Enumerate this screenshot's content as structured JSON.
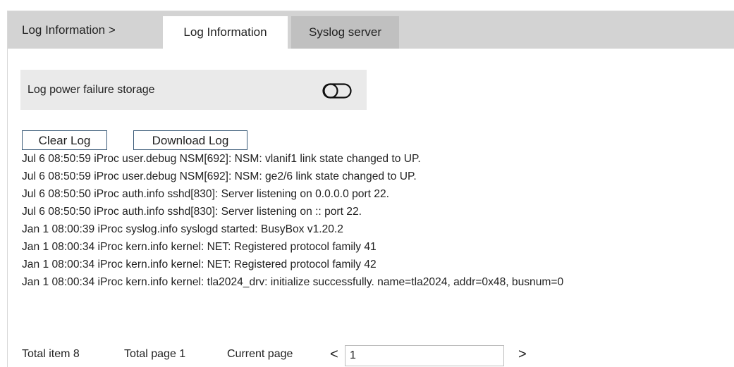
{
  "header": {
    "breadcrumb": "Log Information   >",
    "tabs": [
      {
        "label": "Log Information",
        "active": true
      },
      {
        "label": "Syslog server",
        "active": false
      }
    ]
  },
  "settings": {
    "power_failure_label": "Log power failure storage",
    "power_failure_enabled": false
  },
  "toolbar": {
    "clear_label": "Clear Log",
    "download_label": "Download Log"
  },
  "logs": [
    "Jul 6 08:50:59 iProc user.debug NSM[692]: NSM: vlanif1 link state changed to UP.",
    "Jul 6 08:50:59 iProc user.debug NSM[692]: NSM: ge2/6 link state changed to UP.",
    "Jul 6 08:50:50 iProc auth.info sshd[830]: Server listening on 0.0.0.0 port 22.",
    "Jul 6 08:50:50 iProc auth.info sshd[830]: Server listening on :: port 22.",
    "Jan 1 08:00:39 iProc syslog.info syslogd started: BusyBox v1.20.2",
    "Jan 1 08:00:34 iProc kern.info kernel: NET: Registered protocol family 41",
    "Jan 1 08:00:34 iProc kern.info kernel: NET: Registered protocol family 42",
    "Jan 1 08:00:34 iProc kern.info kernel: tla2024_drv: initialize successfully. name=tla2024, addr=0x48, busnum=0"
  ],
  "pagination": {
    "total_items": "Total item 8",
    "total_pages": "Total page 1",
    "current_label": "Current page",
    "prev": "<",
    "current_value": "1",
    "next": ">"
  },
  "colors": {
    "tab_bar": "#d3d3d3",
    "inactive_tab": "#c0c0c0",
    "setting_bg": "#eaeaea",
    "button_border": "#3a5a78"
  },
  "icons": {
    "toggle": "toggle-switch-icon",
    "prev": "chevron-left-icon",
    "next": "chevron-right-icon"
  }
}
